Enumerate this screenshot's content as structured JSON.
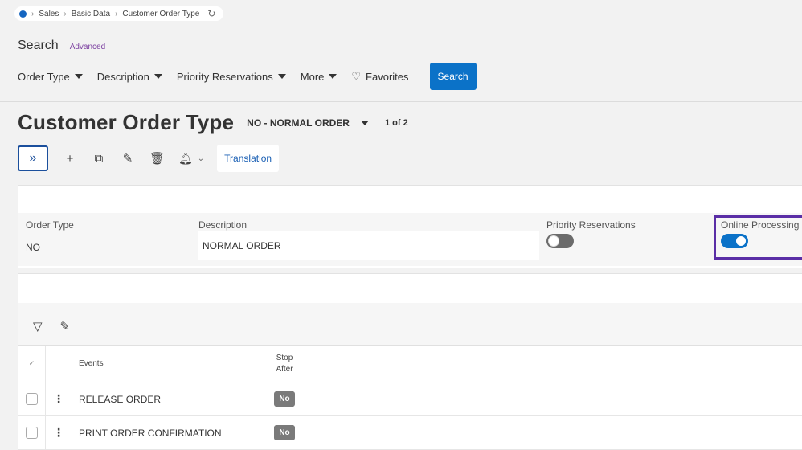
{
  "breadcrumb": {
    "items": [
      "Sales",
      "Basic Data",
      "Customer Order Type"
    ]
  },
  "search": {
    "title": "Search",
    "advanced_label": "Advanced",
    "filters": [
      "Order Type",
      "Description",
      "Priority Reservations",
      "More"
    ],
    "favorites_label": "Favorites",
    "search_button": "Search"
  },
  "page": {
    "title": "Customer Order Type",
    "record_label": "NO - NORMAL ORDER",
    "record_count": "1 of 2"
  },
  "toolbar": {
    "translation_label": "Translation"
  },
  "header_record": {
    "order_type_label": "Order Type",
    "order_type_value": "NO",
    "description_label": "Description",
    "description_value": "NORMAL ORDER",
    "priority_label": "Priority Reservations",
    "priority_on": false,
    "online_label": "Online Processing",
    "online_on": true
  },
  "events_grid": {
    "columns": {
      "select": "✓",
      "events": "Events",
      "stop_after": "Stop After"
    },
    "rows": [
      {
        "event": "RELEASE ORDER",
        "stop_after": "No"
      },
      {
        "event": "PRINT ORDER CONFIRMATION",
        "stop_after": "No"
      }
    ]
  },
  "colors": {
    "accent": "#0b72c8",
    "highlight_border": "#5a2ea6",
    "badge": "#7a7a7a"
  }
}
